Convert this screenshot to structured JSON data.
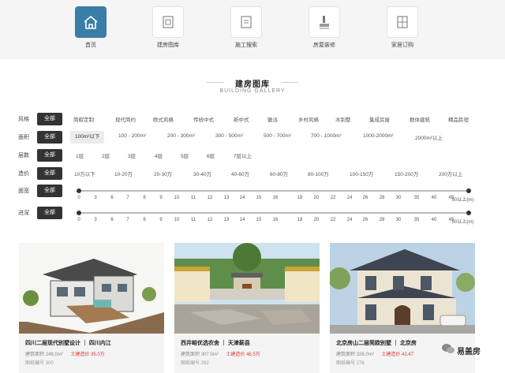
{
  "nav": [
    {
      "label": "首页",
      "icon": "home-icon",
      "active": true
    },
    {
      "label": "建房图库",
      "icon": "gallery-icon",
      "active": false
    },
    {
      "label": "施工搜索",
      "icon": "construction-search-icon",
      "active": false
    },
    {
      "label": "房屋装修",
      "icon": "renovation-icon",
      "active": false
    },
    {
      "label": "家居订购",
      "icon": "furniture-icon",
      "active": false
    }
  ],
  "heading": {
    "title": "建房图库",
    "subtitle": "BUILDING GALLERY"
  },
  "filters": {
    "all_label": "全部",
    "style": {
      "label": "风格",
      "options": [
        "简碳定制",
        "现代简约",
        "欧式风格",
        "传统中式",
        "新中式",
        "徽派",
        "乡村风格",
        "木别墅",
        "集成房屋",
        "群体建筑",
        "精品民宿"
      ]
    },
    "area": {
      "label": "面积",
      "options": [
        "100m²以下",
        "100 - 200m²",
        "200 - 300m²",
        "300 - 500m²",
        "500 - 700m²",
        "700 - 1000m²",
        "1000-2000m²",
        "2000m²以上"
      ]
    },
    "floors": {
      "label": "层数",
      "options": [
        "1层",
        "2层",
        "3层",
        "4层",
        "5层",
        "6层",
        "7层以上"
      ]
    },
    "cost": {
      "label": "造价",
      "options": [
        "10万以下",
        "10-20万",
        "20-30万",
        "30-40万",
        "40-60万",
        "60-80万",
        "80-100万",
        "100-150万",
        "150-200万",
        "200万以上"
      ]
    },
    "width": {
      "label": "面宽"
    },
    "depth": {
      "label": "进深"
    },
    "ticks": [
      "0",
      "3",
      "6",
      "7",
      "8",
      "9",
      "10",
      "11",
      "12",
      "13",
      "14",
      "15",
      "16",
      "18",
      "20",
      "22",
      "24",
      "26",
      "28",
      "30",
      "35",
      "40",
      "45",
      "50以上(m)"
    ]
  },
  "cards": [
    {
      "title": "四川二层现代别墅设计 ｜ 四川内江",
      "area_label": "建筑面积",
      "area": "249.0m²",
      "price_label": "土建造价",
      "price": "35.0万",
      "code_label": "图纸编号",
      "code": "300"
    },
    {
      "title": "西井峪优选农舍 ｜ 天津蓟县",
      "area_label": "建筑面积",
      "area": "307.0m²",
      "price_label": "土建造价",
      "price": "46.5万",
      "code_label": "图纸编号",
      "code": "292"
    },
    {
      "title": "北京房山二层简欧别墅 ｜ 北京房",
      "area_label": "建筑面积",
      "area": "326.0m²",
      "price_label": "土建造价",
      "price": "42.47",
      "code_label": "图纸编号",
      "code": "276"
    }
  ],
  "watermark": {
    "text": "易盖房"
  },
  "colors": {
    "accent": "#3a7ea8",
    "price": "#dd3333",
    "dark_button": "#333333"
  }
}
